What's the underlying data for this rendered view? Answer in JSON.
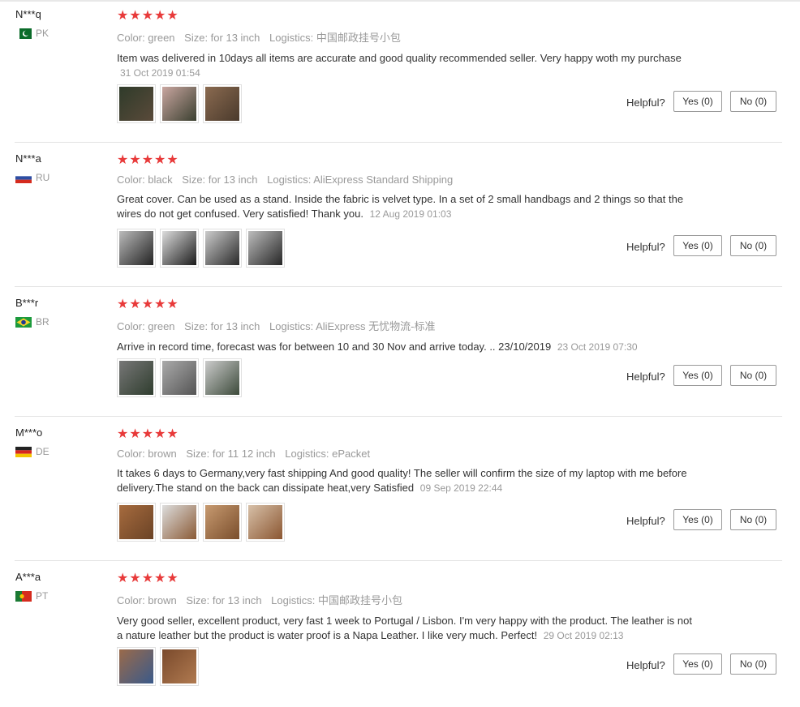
{
  "helpful_label": "Helpful?",
  "star_glyph": "★★★★★",
  "reviews": [
    {
      "user": "N***q",
      "country": "PK",
      "flag_icon": "pakistan-flag-icon",
      "color": "Color: green",
      "size": "Size: for 13 inch",
      "logistics": "Logistics: 中国邮政挂号小包",
      "text": "Item was delivered in 10days all items are accurate and good quality recommended seller. Very happy woth my purchase",
      "date": "31 Oct 2019 01:54",
      "photo_count": 3,
      "yes": "Yes (0)",
      "no": "No (0)"
    },
    {
      "user": "N***a",
      "country": "RU",
      "flag_icon": "russia-flag-icon",
      "color": "Color: black",
      "size": "Size: for 13 inch",
      "logistics": "Logistics: AliExpress Standard Shipping",
      "text": "Great cover. Can be used as a stand. Inside the fabric is velvet type. In a set of 2 small handbags and 2 things so that the wires do not get confused. Very satisfied! Thank you.",
      "date": "12 Aug 2019 01:03",
      "photo_count": 4,
      "yes": "Yes (0)",
      "no": "No (0)"
    },
    {
      "user": "B***r",
      "country": "BR",
      "flag_icon": "brazil-flag-icon",
      "color": "Color: green",
      "size": "Size: for 13 inch",
      "logistics": "Logistics: AliExpress 无忧物流-标准",
      "text": "Arrive in record time, forecast was for between 10 and 30 Nov and arrive today. .. 23/10/2019",
      "date": "23 Oct 2019 07:30",
      "photo_count": 3,
      "yes": "Yes (0)",
      "no": "No (0)"
    },
    {
      "user": "M***o",
      "country": "DE",
      "flag_icon": "germany-flag-icon",
      "color": "Color: brown",
      "size": "Size: for 11 12 inch",
      "logistics": "Logistics: ePacket",
      "text": "It takes 6 days to Germany,very fast shipping And good quality! The seller will confirm the size of my laptop with me before delivery.The stand on the back can dissipate heat,very Satisfied",
      "date": "09 Sep 2019 22:44",
      "photo_count": 4,
      "yes": "Yes (0)",
      "no": "No (0)"
    },
    {
      "user": "A***a",
      "country": "PT",
      "flag_icon": "portugal-flag-icon",
      "color": "Color: brown",
      "size": "Size: for 13 inch",
      "logistics": "Logistics: 中国邮政挂号小包",
      "text": "Very good seller, excellent product, very fast 1 week to Portugal / Lisbon. I'm very happy with the product. The leather is not a nature leather but the product is water proof is a Napa Leather. I like very much. Perfect!",
      "date": "29 Oct 2019 02:13",
      "photo_count": 2,
      "yes": "Yes (0)",
      "no": "No (0)"
    }
  ]
}
